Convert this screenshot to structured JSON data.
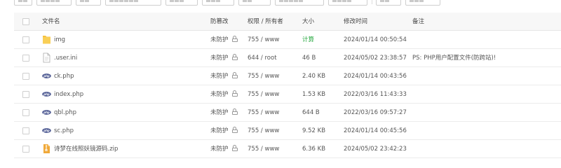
{
  "table": {
    "headers": {
      "name": "文件名",
      "guard": "防篡改",
      "perm": "权限 / 所有者",
      "size": "大小",
      "time": "修改时间",
      "note": "备注"
    },
    "rows": [
      {
        "type": "folder",
        "icon": "folder-icon",
        "name": "img",
        "guard": "未防护",
        "perm": "755 / www",
        "size": "计算",
        "time": "2024/01/14 00:50:54",
        "note": ""
      },
      {
        "type": "ini",
        "icon": "file-icon",
        "name": ".user.ini",
        "guard": "未防护",
        "perm": "644 / root",
        "size": "46 B",
        "time": "2024/05/02 23:38:57",
        "note": "PS: PHP用户配置文件(防跨站)!"
      },
      {
        "type": "php",
        "icon": "php-icon",
        "name": "ck.php",
        "guard": "未防护",
        "perm": "755 / www",
        "size": "2.40 KB",
        "time": "2024/01/14 00:43:56",
        "note": ""
      },
      {
        "type": "php",
        "icon": "php-icon",
        "name": "index.php",
        "guard": "未防护",
        "perm": "755 / www",
        "size": "1.53 KB",
        "time": "2022/03/16 11:43:33",
        "note": ""
      },
      {
        "type": "php",
        "icon": "php-icon",
        "name": "qbl.php",
        "guard": "未防护",
        "perm": "755 / www",
        "size": "644 B",
        "time": "2022/03/16 09:57:27",
        "note": ""
      },
      {
        "type": "php",
        "icon": "php-icon",
        "name": "sc.php",
        "guard": "未防护",
        "perm": "755 / www",
        "size": "9.52 KB",
        "time": "2024/01/14 00:45:56",
        "note": ""
      },
      {
        "type": "zip",
        "icon": "zip-icon",
        "name": "诗梦在线照妖镜源码.zip",
        "guard": "未防护",
        "perm": "755 / www",
        "size": "6.36 KB",
        "time": "2024/05/02 23:42:23",
        "note": ""
      }
    ]
  },
  "colors": {
    "accent_green": "#20a53a",
    "folder": "#f5c13d",
    "php": "#4f5b93"
  }
}
